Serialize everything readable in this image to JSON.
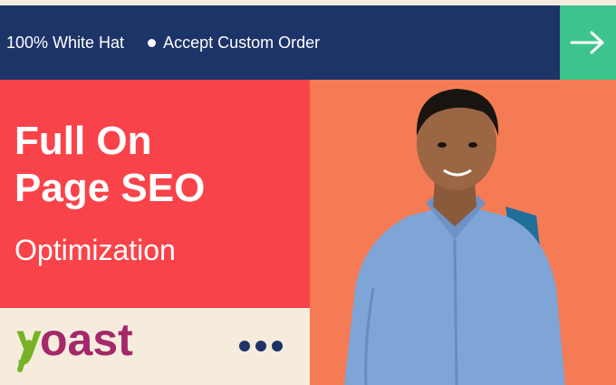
{
  "banner": {
    "item1": "100% White Hat",
    "item2": "Accept Custom Order"
  },
  "icons": {
    "arrow": "arrow-right-icon",
    "bullet": "bullet-icon",
    "more": "more-dots-icon"
  },
  "hero": {
    "title_line1": "Full On",
    "title_line2": "Page SEO",
    "subtitle": "Optimization"
  },
  "logo": {
    "text": "yoast"
  },
  "colors": {
    "banner_bg": "#1d3469",
    "arrow_bg": "#3cc48c",
    "left_panel_bg": "#f9434a",
    "photo_bg": "#f47b53",
    "cream_bg": "#f6ecdd",
    "logo_green": "#77b227",
    "logo_purple": "#a4286a"
  }
}
